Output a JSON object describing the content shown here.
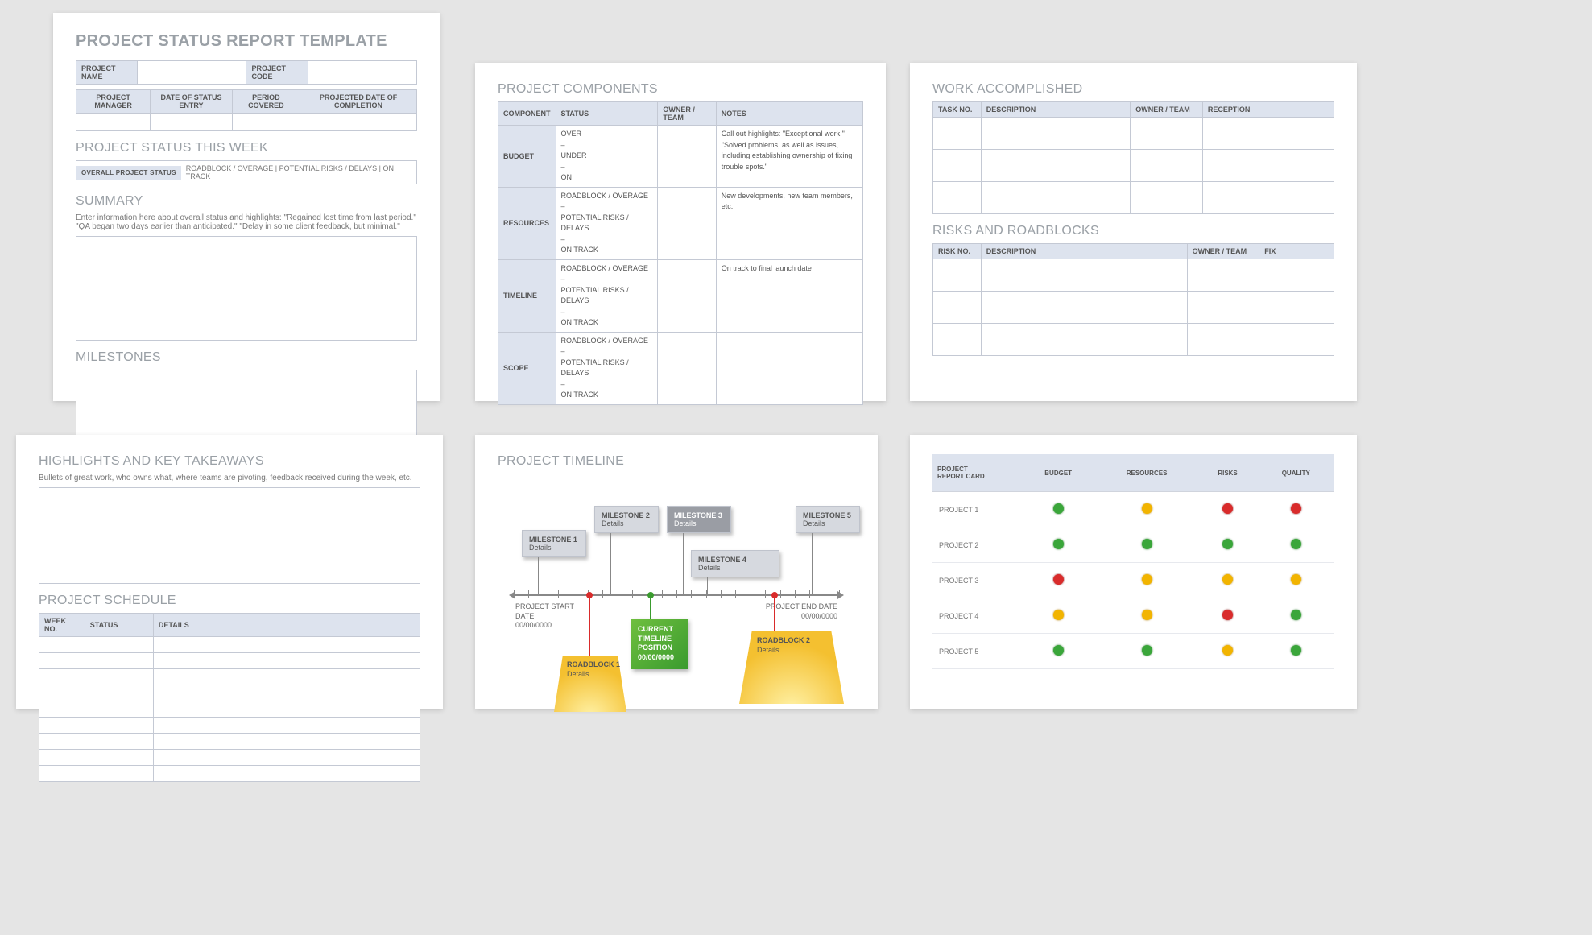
{
  "card1": {
    "title": "PROJECT STATUS REPORT TEMPLATE",
    "header": {
      "name_lbl": "PROJECT NAME",
      "code_lbl": "PROJECT CODE",
      "pm": "PROJECT MANAGER",
      "entry": "DATE OF STATUS ENTRY",
      "period": "PERIOD COVERED",
      "projected": "PROJECTED DATE OF COMPLETION"
    },
    "status_week": "PROJECT STATUS THIS WEEK",
    "status_line": {
      "lbl": "OVERALL PROJECT STATUS",
      "vals": "ROADBLOCK / OVERAGE   |   POTENTIAL RISKS / DELAYS   |   ON TRACK"
    },
    "summary": {
      "title": "SUMMARY",
      "hint": "Enter information here about overall status and highlights: \"Regained lost time from last period.\" \"QA began two days earlier than anticipated.\" \"Delay in some client feedback, but minimal.\""
    },
    "milestones": "MILESTONES"
  },
  "card2": {
    "title": "PROJECT COMPONENTS",
    "cols": [
      "COMPONENT",
      "STATUS",
      "OWNER / TEAM",
      "NOTES"
    ],
    "rows": [
      {
        "c": "BUDGET",
        "s": "OVER\n–\nUNDER\n–\nON",
        "n": "Call out highlights: \"Exceptional work.\" \"Solved problems, as well as issues, including establishing ownership of fixing trouble spots.\""
      },
      {
        "c": "RESOURCES",
        "s": "ROADBLOCK / OVERAGE\n–\nPOTENTIAL RISKS / DELAYS\n–\nON TRACK",
        "n": "New developments, new team members, etc."
      },
      {
        "c": "TIMELINE",
        "s": "ROADBLOCK / OVERAGE\n–\nPOTENTIAL RISKS / DELAYS\n–\nON TRACK",
        "n": "On track to final launch date"
      },
      {
        "c": "SCOPE",
        "s": "ROADBLOCK / OVERAGE\n–\nPOTENTIAL RISKS / DELAYS\n–\nON TRACK",
        "n": ""
      }
    ]
  },
  "card3": {
    "wa": {
      "title": "WORK ACCOMPLISHED",
      "cols": [
        "TASK NO.",
        "DESCRIPTION",
        "OWNER / TEAM",
        "RECEPTION"
      ]
    },
    "rr": {
      "title": "RISKS AND ROADBLOCKS",
      "cols": [
        "RISK NO.",
        "DESCRIPTION",
        "OWNER / TEAM",
        "FIX"
      ]
    }
  },
  "card4": {
    "highlights": {
      "title": "HIGHLIGHTS AND KEY TAKEAWAYS",
      "hint": "Bullets of great work, who owns what, where teams are pivoting, feedback received during the week, etc."
    },
    "schedule": {
      "title": "PROJECT SCHEDULE",
      "cols": [
        "WEEK NO.",
        "STATUS",
        "DETAILS"
      ],
      "rows": 9
    }
  },
  "card5": {
    "title": "PROJECT TIMELINE",
    "start": {
      "l1": "PROJECT START DATE",
      "l2": "00/00/0000"
    },
    "end": {
      "l1": "PROJECT END DATE",
      "l2": "00/00/0000"
    },
    "ms": [
      "MILESTONE 1",
      "MILESTONE 2",
      "MILESTONE 3",
      "MILESTONE 4",
      "MILESTONE 5"
    ],
    "detail": "Details",
    "current": {
      "l1": "CURRENT",
      "l2": "TIMELINE",
      "l3": "POSITION",
      "l4": "00/00/0000"
    },
    "rb": [
      "ROADBLOCK 1",
      "ROADBLOCK 2"
    ]
  },
  "card6": {
    "header": {
      "lbl": "PROJECT REPORT CARD",
      "cols": [
        "BUDGET",
        "RESOURCES",
        "RISKS",
        "QUALITY"
      ]
    },
    "rows": [
      {
        "name": "PROJECT 1",
        "v": [
          "g",
          "y",
          "r",
          "r"
        ]
      },
      {
        "name": "PROJECT 2",
        "v": [
          "g",
          "g",
          "g",
          "g"
        ]
      },
      {
        "name": "PROJECT 3",
        "v": [
          "r",
          "y",
          "y",
          "y"
        ]
      },
      {
        "name": "PROJECT 4",
        "v": [
          "y",
          "y",
          "r",
          "g"
        ]
      },
      {
        "name": "PROJECT 5",
        "v": [
          "g",
          "g",
          "y",
          "g"
        ]
      }
    ]
  },
  "chart_data": {
    "type": "table",
    "title": "Project Report Card",
    "categories": [
      "BUDGET",
      "RESOURCES",
      "RISKS",
      "QUALITY"
    ],
    "series": [
      {
        "name": "PROJECT 1",
        "values": [
          "green",
          "yellow",
          "red",
          "red"
        ]
      },
      {
        "name": "PROJECT 2",
        "values": [
          "green",
          "green",
          "green",
          "green"
        ]
      },
      {
        "name": "PROJECT 3",
        "values": [
          "red",
          "yellow",
          "yellow",
          "yellow"
        ]
      },
      {
        "name": "PROJECT 4",
        "values": [
          "yellow",
          "yellow",
          "red",
          "green"
        ]
      },
      {
        "name": "PROJECT 5",
        "values": [
          "green",
          "green",
          "yellow",
          "green"
        ]
      }
    ]
  }
}
